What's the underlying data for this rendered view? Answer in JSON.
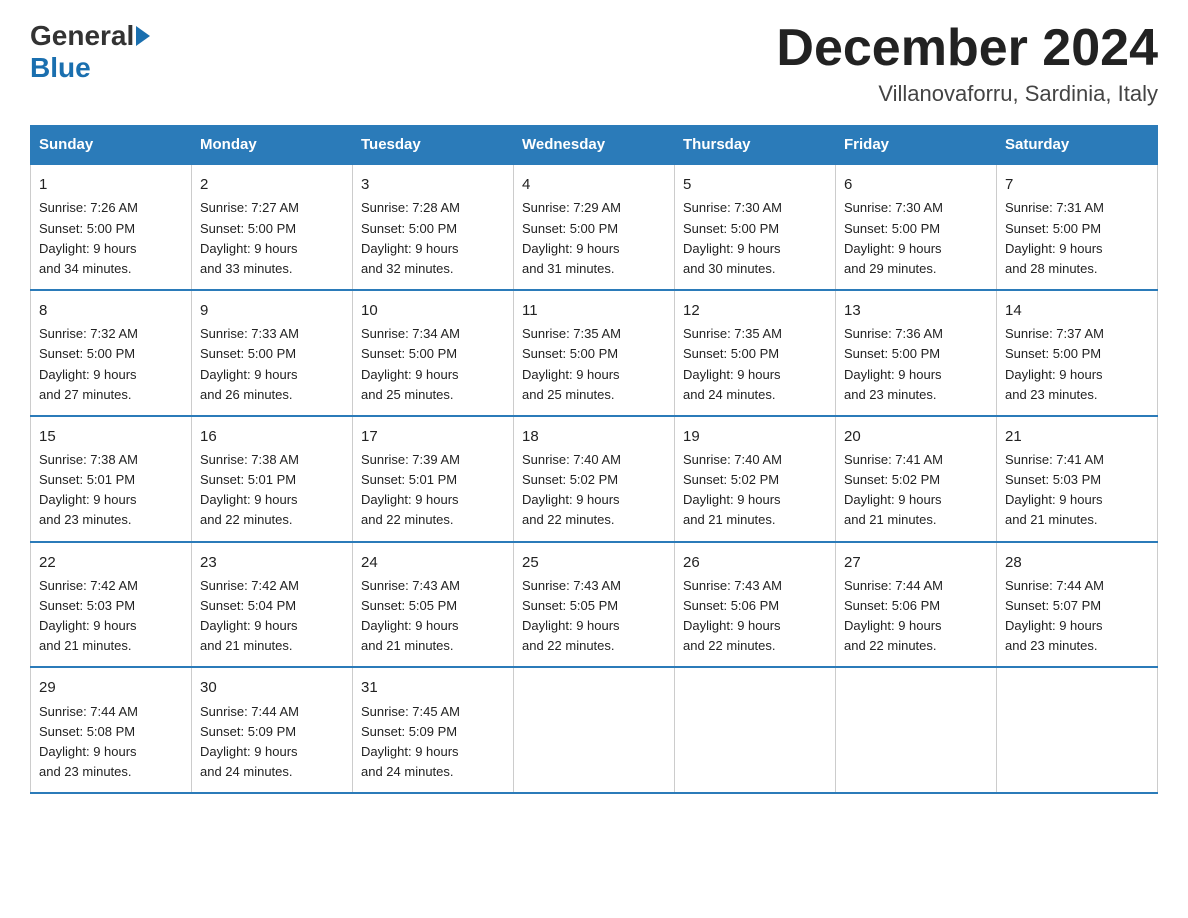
{
  "header": {
    "logo_general": "General",
    "logo_blue": "Blue",
    "title": "December 2024",
    "subtitle": "Villanovaforru, Sardinia, Italy"
  },
  "weekdays": [
    "Sunday",
    "Monday",
    "Tuesday",
    "Wednesday",
    "Thursday",
    "Friday",
    "Saturday"
  ],
  "weeks": [
    [
      {
        "num": "1",
        "sunrise": "7:26 AM",
        "sunset": "5:00 PM",
        "daylight": "9 hours and 34 minutes."
      },
      {
        "num": "2",
        "sunrise": "7:27 AM",
        "sunset": "5:00 PM",
        "daylight": "9 hours and 33 minutes."
      },
      {
        "num": "3",
        "sunrise": "7:28 AM",
        "sunset": "5:00 PM",
        "daylight": "9 hours and 32 minutes."
      },
      {
        "num": "4",
        "sunrise": "7:29 AM",
        "sunset": "5:00 PM",
        "daylight": "9 hours and 31 minutes."
      },
      {
        "num": "5",
        "sunrise": "7:30 AM",
        "sunset": "5:00 PM",
        "daylight": "9 hours and 30 minutes."
      },
      {
        "num": "6",
        "sunrise": "7:30 AM",
        "sunset": "5:00 PM",
        "daylight": "9 hours and 29 minutes."
      },
      {
        "num": "7",
        "sunrise": "7:31 AM",
        "sunset": "5:00 PM",
        "daylight": "9 hours and 28 minutes."
      }
    ],
    [
      {
        "num": "8",
        "sunrise": "7:32 AM",
        "sunset": "5:00 PM",
        "daylight": "9 hours and 27 minutes."
      },
      {
        "num": "9",
        "sunrise": "7:33 AM",
        "sunset": "5:00 PM",
        "daylight": "9 hours and 26 minutes."
      },
      {
        "num": "10",
        "sunrise": "7:34 AM",
        "sunset": "5:00 PM",
        "daylight": "9 hours and 25 minutes."
      },
      {
        "num": "11",
        "sunrise": "7:35 AM",
        "sunset": "5:00 PM",
        "daylight": "9 hours and 25 minutes."
      },
      {
        "num": "12",
        "sunrise": "7:35 AM",
        "sunset": "5:00 PM",
        "daylight": "9 hours and 24 minutes."
      },
      {
        "num": "13",
        "sunrise": "7:36 AM",
        "sunset": "5:00 PM",
        "daylight": "9 hours and 23 minutes."
      },
      {
        "num": "14",
        "sunrise": "7:37 AM",
        "sunset": "5:00 PM",
        "daylight": "9 hours and 23 minutes."
      }
    ],
    [
      {
        "num": "15",
        "sunrise": "7:38 AM",
        "sunset": "5:01 PM",
        "daylight": "9 hours and 23 minutes."
      },
      {
        "num": "16",
        "sunrise": "7:38 AM",
        "sunset": "5:01 PM",
        "daylight": "9 hours and 22 minutes."
      },
      {
        "num": "17",
        "sunrise": "7:39 AM",
        "sunset": "5:01 PM",
        "daylight": "9 hours and 22 minutes."
      },
      {
        "num": "18",
        "sunrise": "7:40 AM",
        "sunset": "5:02 PM",
        "daylight": "9 hours and 22 minutes."
      },
      {
        "num": "19",
        "sunrise": "7:40 AM",
        "sunset": "5:02 PM",
        "daylight": "9 hours and 21 minutes."
      },
      {
        "num": "20",
        "sunrise": "7:41 AM",
        "sunset": "5:02 PM",
        "daylight": "9 hours and 21 minutes."
      },
      {
        "num": "21",
        "sunrise": "7:41 AM",
        "sunset": "5:03 PM",
        "daylight": "9 hours and 21 minutes."
      }
    ],
    [
      {
        "num": "22",
        "sunrise": "7:42 AM",
        "sunset": "5:03 PM",
        "daylight": "9 hours and 21 minutes."
      },
      {
        "num": "23",
        "sunrise": "7:42 AM",
        "sunset": "5:04 PM",
        "daylight": "9 hours and 21 minutes."
      },
      {
        "num": "24",
        "sunrise": "7:43 AM",
        "sunset": "5:05 PM",
        "daylight": "9 hours and 21 minutes."
      },
      {
        "num": "25",
        "sunrise": "7:43 AM",
        "sunset": "5:05 PM",
        "daylight": "9 hours and 22 minutes."
      },
      {
        "num": "26",
        "sunrise": "7:43 AM",
        "sunset": "5:06 PM",
        "daylight": "9 hours and 22 minutes."
      },
      {
        "num": "27",
        "sunrise": "7:44 AM",
        "sunset": "5:06 PM",
        "daylight": "9 hours and 22 minutes."
      },
      {
        "num": "28",
        "sunrise": "7:44 AM",
        "sunset": "5:07 PM",
        "daylight": "9 hours and 23 minutes."
      }
    ],
    [
      {
        "num": "29",
        "sunrise": "7:44 AM",
        "sunset": "5:08 PM",
        "daylight": "9 hours and 23 minutes."
      },
      {
        "num": "30",
        "sunrise": "7:44 AM",
        "sunset": "5:09 PM",
        "daylight": "9 hours and 24 minutes."
      },
      {
        "num": "31",
        "sunrise": "7:45 AM",
        "sunset": "5:09 PM",
        "daylight": "9 hours and 24 minutes."
      },
      null,
      null,
      null,
      null
    ]
  ],
  "labels": {
    "sunrise": "Sunrise:",
    "sunset": "Sunset:",
    "daylight": "Daylight:"
  }
}
